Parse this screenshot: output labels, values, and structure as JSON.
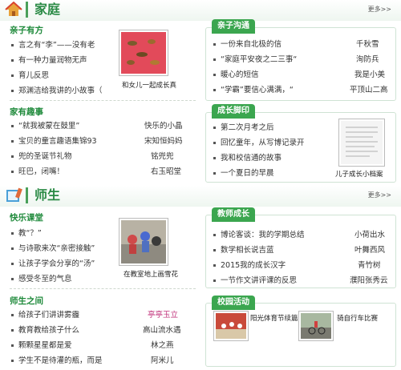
{
  "family": {
    "title": "家庭",
    "more": "更多>>",
    "qinzi_youfang": {
      "heading": "亲子有方",
      "items": [
        "言之有“李”——没有老",
        "有一种力量润物无声",
        "育儿反思",
        "郑渊洁给我讲的小故事（"
      ],
      "caption": "和女儿一起成长真"
    },
    "jiayou_qushi": {
      "heading": "家有趣事",
      "items": [
        {
          "t": "“就我被蒙在鼓里”",
          "a": "快乐的小晶"
        },
        {
          "t": "宝贝的童言趣语集锦93",
          "a": "宋知恒妈妈"
        },
        {
          "t": "兜的圣诞节礼物",
          "a": "铭兜兜"
        },
        {
          "t": "旺巴，闭嘴！",
          "a": "右玉昭堂"
        }
      ]
    },
    "qinzi_goutong": {
      "tab": "亲子沟通",
      "items": [
        {
          "t": "一份来自北极的信",
          "a": "千秋雪"
        },
        {
          "t": "“家庭平安夜之二三事“",
          "a": "洵防兵"
        },
        {
          "t": "暖心的短信",
          "a": "我是小美"
        },
        {
          "t": "“学霸”要信心满满，“",
          "a": "平顶山二高"
        }
      ]
    },
    "chengzhang": {
      "tab": "成长脚印",
      "items": [
        "第二次月考之后",
        "回忆童年，从写博记录开",
        "我和校信通的故事",
        "一个夏日的早晨"
      ],
      "caption": "儿子成长小档案"
    }
  },
  "teacher": {
    "title": "师生",
    "more": "更多>>",
    "kuaile": {
      "heading": "快乐课堂",
      "items": [
        "教“？”",
        "与诗歌来次“亲密接触”",
        "让孩子学会分享的“汤”",
        "感受冬至的气息"
      ],
      "caption": "在教室地上画雪花"
    },
    "shisheng": {
      "heading": "师生之间",
      "items": [
        {
          "t": "给孩子们讲讲雾霾",
          "a": "亭亭玉立"
        },
        {
          "t": "教育教给孩子什么",
          "a": "高山流水遇"
        },
        {
          "t": "颗颗星星都是爱",
          "a": "林之燕"
        },
        {
          "t": "学生不是待灌的瓶，而是",
          "a": "阿米儿"
        }
      ]
    },
    "jiaoshi": {
      "tab": "教师成长",
      "items": [
        {
          "t": "博论客谈：我的学期总结",
          "a": "小荷出水"
        },
        {
          "t": "数学相长说吉蓝",
          "a": "叶舞西风"
        },
        {
          "t": "2015我的成长汉字",
          "a": "青竹树"
        },
        {
          "t": "一节作文讲评课的反思",
          "a": "濮阳张秀云"
        }
      ]
    },
    "xiaoyuan": {
      "tab": "校园活动",
      "cap1": "阳光体育节续篇",
      "cap2": "骑自行车比赛"
    }
  },
  "colors": {
    "accent": "#3ba64f",
    "heading": "#1f8a3b",
    "author_highlight": "#c0307a"
  }
}
